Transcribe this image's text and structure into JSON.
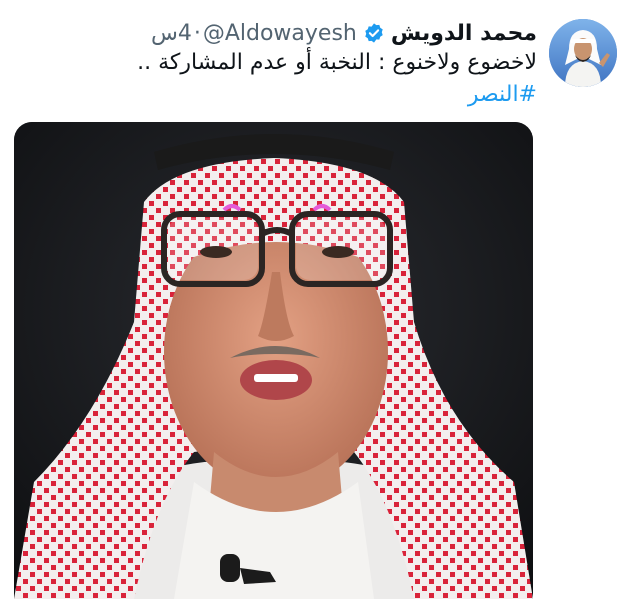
{
  "tweet": {
    "display_name": "محمد الدويش",
    "handle": "@Aldowayesh",
    "separator": "·",
    "time_value": "4",
    "time_unit": "س",
    "text": "لاخضوع ولاخنوع : النخبة أو عدم المشاركة ..",
    "hashtag": "#النصر"
  },
  "icons": {
    "verified": "verified-badge-icon",
    "avatar": "profile-avatar",
    "media": "attached-photo"
  },
  "colors": {
    "name": "#0f1419",
    "muted": "#536471",
    "link": "#1d9bf0",
    "verified": "#1d9bf0"
  }
}
